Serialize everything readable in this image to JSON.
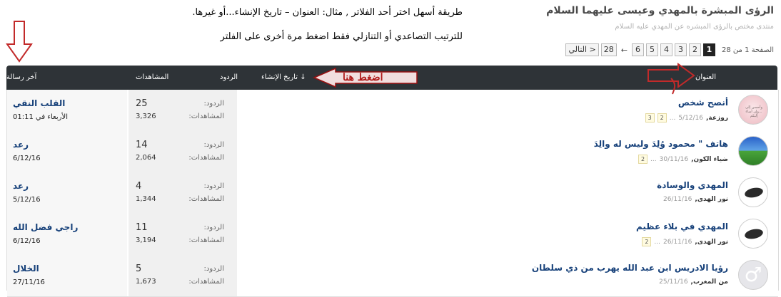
{
  "forum": {
    "title": "الرؤى المبشرة بالمهدي وعيسى عليهما السلام",
    "description": "منتدى مختص بالرؤى المبشره عن المهدي عليه السلام"
  },
  "instructions": {
    "line1": "طريقة أسهل اختر أحد الفلاتر , مثال: العنوان – تاريخ الإنشاء...أو غيرها.",
    "line2": "للترتيب التصاعدي أو التنازلي فقط اضغط مرة أخرى على الفلتر"
  },
  "pagination": {
    "info": "الصفحة 1 من 28",
    "pages": [
      "1",
      "2",
      "3",
      "4",
      "5",
      "6"
    ],
    "current": "1",
    "ellipsis": "←",
    "last": "28",
    "next": "التالي >"
  },
  "table_header": {
    "title": "العنوان",
    "created": "تاريخ الإنشاء ↓",
    "replies": "الردود",
    "views": "المشاهدات",
    "last_post": "آخر رسالة"
  },
  "annotation": {
    "press_here": "اضغط هنا"
  },
  "labels": {
    "replies": "الردود:",
    "views": "المشاهدات:"
  },
  "threads": [
    {
      "title": "أنصح شخص",
      "author": "روزعة,",
      "date": "5/12/16",
      "pages": [
        "3",
        "2"
      ],
      "replies": "25",
      "views": "3,326",
      "last_user": "القلب النقي",
      "last_date": "الأربعاء في 01:11",
      "avatar": "avatar-pink",
      "avatar_text": "وأحسن إلى ...وإن أساء إليكم"
    },
    {
      "title": "هاتف \" محمود وُلِدَ وليس له والِدَ",
      "author": "ضياء الكون,",
      "date": "30/11/16",
      "pages": [
        "2"
      ],
      "replies": "14",
      "views": "2,064",
      "last_user": "رعد",
      "last_date": "6/12/16",
      "avatar": "avatar-landscape"
    },
    {
      "title": "المهدي والوسادة",
      "author": "نور الهدى,",
      "date": "26/11/16",
      "pages": [],
      "replies": "4",
      "views": "1,344",
      "last_user": "رعد",
      "last_date": "5/12/16",
      "avatar": "avatar-stone"
    },
    {
      "title": "المهدي في بلاء عظيم",
      "author": "نور الهدى,",
      "date": "26/11/16",
      "pages": [
        "2"
      ],
      "replies": "11",
      "views": "3,194",
      "last_user": "راجي فضل الله",
      "last_date": "6/12/16",
      "avatar": "avatar-stone"
    },
    {
      "title": "رؤيا الادريس ابن عبد الله يهرب من ذي سلطان",
      "author": "من المغرب,",
      "date": "25/11/16",
      "pages": [],
      "replies": "5",
      "views": "1,673",
      "last_user": "الخلال",
      "last_date": "27/11/16",
      "avatar": "avatar-male"
    }
  ],
  "colors": {
    "header_bg": "#2e3337",
    "link": "#17417a",
    "annotation_red": "#b01a1a"
  }
}
